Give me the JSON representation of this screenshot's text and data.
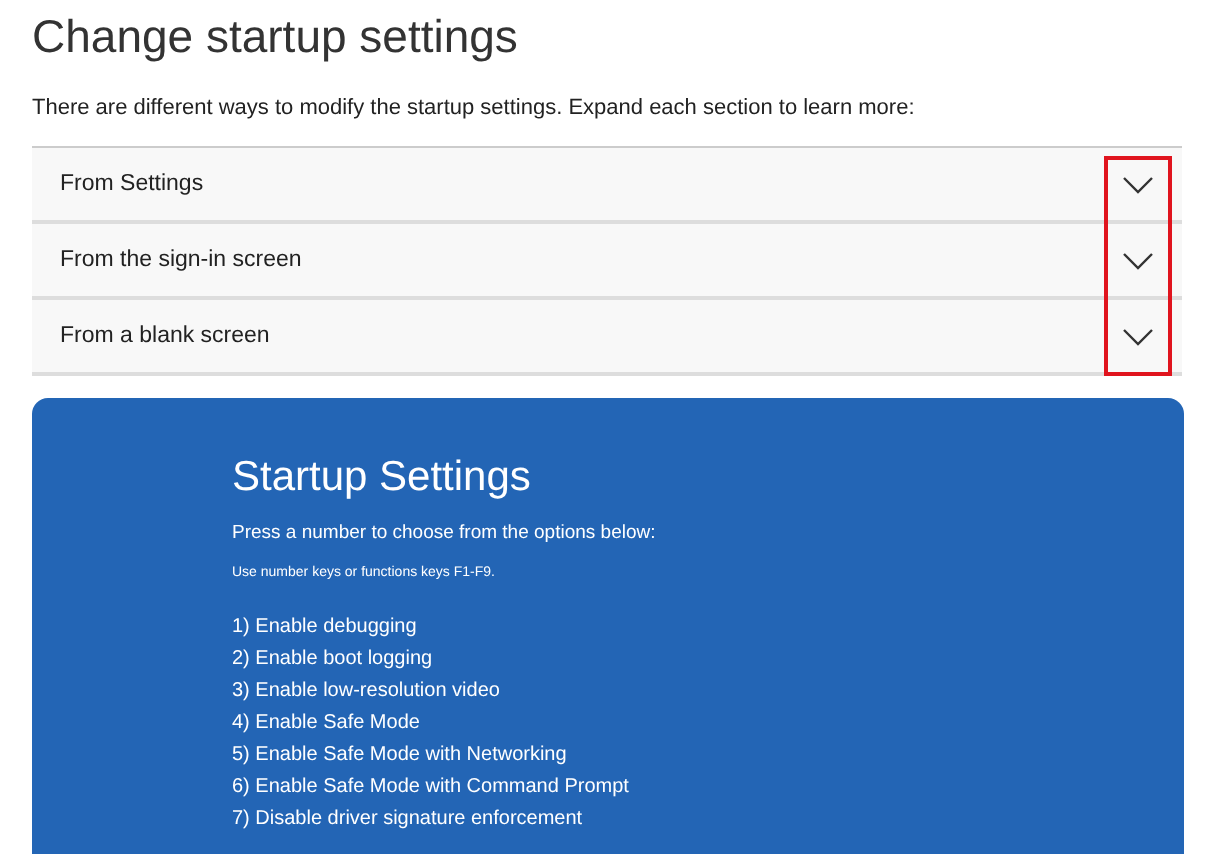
{
  "page": {
    "title": "Change startup settings",
    "intro": "There are different ways to modify the startup settings. Expand each section to learn more:"
  },
  "sections": [
    {
      "label": "From Settings",
      "expanded": false
    },
    {
      "label": "From the sign-in screen",
      "expanded": false
    },
    {
      "label": "From a blank screen",
      "expanded": false
    }
  ],
  "screenshot": {
    "title": "Startup Settings",
    "prompt": "Press a number to choose from the options below:",
    "hint": "Use number keys or functions keys F1-F9.",
    "options": [
      "1) Enable debugging",
      "2) Enable boot logging",
      "3) Enable low-resolution video",
      "4) Enable Safe Mode",
      "5) Enable Safe Mode with Networking",
      "6) Enable Safe Mode with Command Prompt",
      "7) Disable driver signature enforcement"
    ]
  }
}
